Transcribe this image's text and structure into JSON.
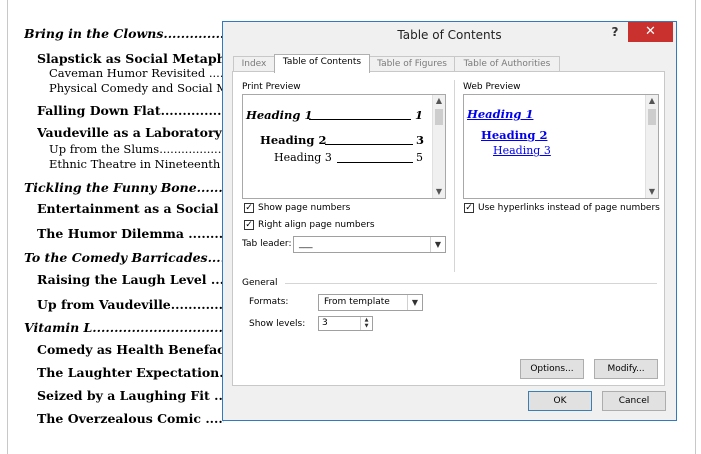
{
  "document": {
    "toc_lines": [
      {
        "level": 1,
        "text": "Bring in the Clowns.................................................."
      },
      {
        "level": 2,
        "text": "Slapstick as Social Metaphor ..............."
      },
      {
        "level": 3,
        "text": "Caveman Humor Revisited ....................."
      },
      {
        "level": 3,
        "text": "Physical Comedy and Social M"
      },
      {
        "level": 2,
        "text": "Falling Down Flat..................................."
      },
      {
        "level": 2,
        "text": "Vaudeville as a Laboratory Exp"
      },
      {
        "level": 3,
        "text": "Up from the Slums......................................"
      },
      {
        "level": 3,
        "text": "Ethnic Theatre in Nineteenth C"
      },
      {
        "level": 1,
        "text": "Tickling the Funny Bone..........................."
      },
      {
        "level": 2,
        "text": "Entertainment as a Social Baron"
      },
      {
        "level": 2,
        "text": "The Humor Dilemma ..............................."
      },
      {
        "level": 1,
        "text": "To the Comedy Barricades........................."
      },
      {
        "level": 2,
        "text": "Raising the Laugh Level ........................."
      },
      {
        "level": 2,
        "text": "Up from Vaudeville................................."
      },
      {
        "level": 1,
        "text": "Vitamin L......................................................"
      },
      {
        "level": 2,
        "text": "Comedy as Health Benefactor ..............."
      },
      {
        "level": 2,
        "text": "The Laughter Expectation........................"
      },
      {
        "level": 2,
        "text": "Seized by a Laughing Fit ........................"
      },
      {
        "level": 2,
        "text": "The Overzealous Comic ........................."
      }
    ]
  },
  "dialog": {
    "title": "Table of Contents",
    "help_label": "?",
    "close_label": "✕",
    "tabs": [
      {
        "label": "Index",
        "active": false
      },
      {
        "label": "Table of Contents",
        "active": true
      },
      {
        "label": "Table of Figures",
        "active": false
      },
      {
        "label": "Table of Authorities",
        "active": false
      }
    ],
    "print_preview": {
      "label": "Print Preview",
      "lines": [
        {
          "text": "Heading 1",
          "page": "1"
        },
        {
          "text": "Heading 2",
          "page": "3"
        },
        {
          "text": "Heading 3",
          "page": "5"
        }
      ]
    },
    "web_preview": {
      "label": "Web Preview",
      "links": [
        "Heading 1",
        "Heading 2",
        "Heading 3"
      ]
    },
    "show_page_numbers": {
      "label": "Show page numbers",
      "checked": true
    },
    "right_align": {
      "label": "Right align page numbers",
      "checked": true
    },
    "use_hyperlinks": {
      "label": "Use hyperlinks instead of page numbers",
      "checked": true
    },
    "tab_leader": {
      "label": "Tab leader:",
      "value": "___"
    },
    "general": {
      "label": "General",
      "formats": {
        "label": "Formats:",
        "value": "From template"
      },
      "show_levels": {
        "label": "Show levels:",
        "value": "3"
      }
    },
    "buttons": {
      "options": "Options...",
      "modify": "Modify...",
      "ok": "OK",
      "cancel": "Cancel"
    }
  }
}
